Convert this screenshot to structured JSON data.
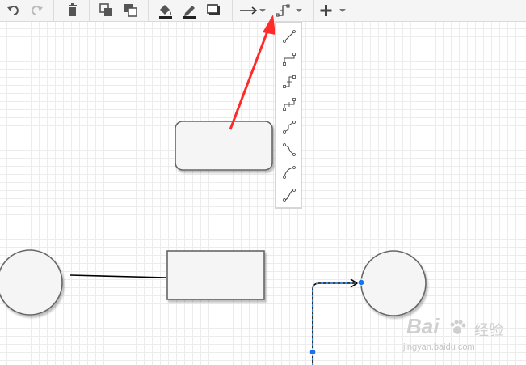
{
  "toolbar": {
    "buttons": [
      {
        "name": "undo-button",
        "icon": "undo-icon"
      },
      {
        "name": "redo-button",
        "icon": "redo-icon"
      },
      {
        "name": "delete-button",
        "icon": "trash-icon"
      },
      {
        "name": "to-front-button",
        "icon": "to-front-icon"
      },
      {
        "name": "to-back-button",
        "icon": "to-back-icon"
      },
      {
        "name": "fill-color-button",
        "icon": "paint-bucket-icon"
      },
      {
        "name": "line-color-button",
        "icon": "pencil-icon"
      },
      {
        "name": "shadow-button",
        "icon": "shadow-icon"
      },
      {
        "name": "connection-style-button",
        "icon": "arrow-right-icon"
      },
      {
        "name": "waypoints-button",
        "icon": "waypoints-icon"
      },
      {
        "name": "insert-button",
        "icon": "plus-icon"
      }
    ]
  },
  "waypoint_menu": {
    "items": [
      {
        "name": "waypoint-straight",
        "icon": "straight-icon"
      },
      {
        "name": "waypoint-orthogonal",
        "icon": "orthogonal-icon"
      },
      {
        "name": "waypoint-horizontal-elbow",
        "icon": "horizontal-elbow-icon"
      },
      {
        "name": "waypoint-vertical-elbow",
        "icon": "vertical-elbow-icon"
      },
      {
        "name": "waypoint-isometric-horizontal",
        "icon": "isometric-horizontal-icon"
      },
      {
        "name": "waypoint-isometric-vertical",
        "icon": "isometric-vertical-icon"
      },
      {
        "name": "waypoint-curved",
        "icon": "curved-icon"
      },
      {
        "name": "waypoint-entity-relation",
        "icon": "entity-relation-icon"
      }
    ]
  },
  "colors": {
    "toolbar_bg": "#f5f5f5",
    "shape_fill": "#f5f5f5",
    "shape_stroke": "#666666",
    "annotation_arrow": "#ff2a2a",
    "handle_blue": "#1a73e8"
  },
  "watermark": {
    "brand": "Bai",
    "chinese": "经验",
    "url": "jingyan.baidu.com"
  }
}
